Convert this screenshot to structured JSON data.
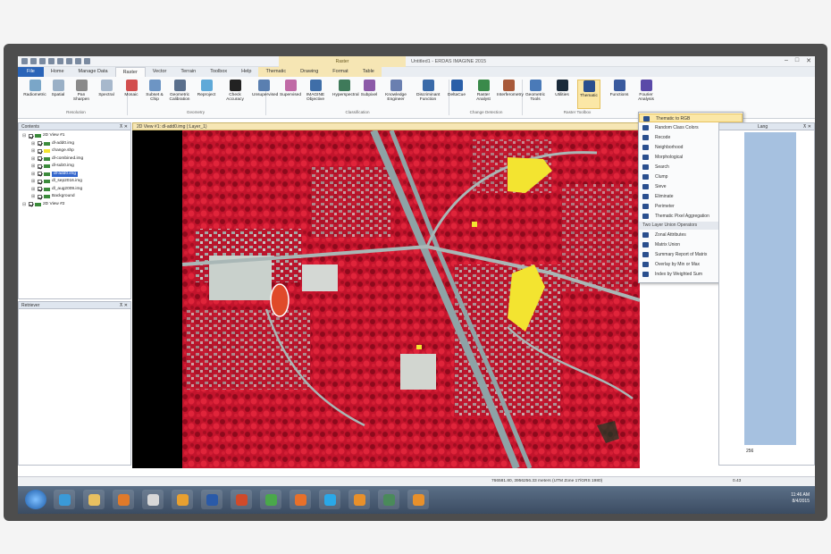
{
  "app": {
    "title": "Untitled1 - ERDAS IMAGINE 2015",
    "context_group": "Raster"
  },
  "tabs": [
    {
      "label": "File"
    },
    {
      "label": "Home"
    },
    {
      "label": "Manage Data"
    },
    {
      "label": "Raster"
    },
    {
      "label": "Vector"
    },
    {
      "label": "Terrain"
    },
    {
      "label": "Toolbox"
    },
    {
      "label": "Help"
    },
    {
      "label": "Thematic"
    },
    {
      "label": "Drawing"
    },
    {
      "label": "Format"
    },
    {
      "label": "Table"
    }
  ],
  "ribbon": {
    "buttons": [
      {
        "label": "Radiometric",
        "color": "#7aa6c8"
      },
      {
        "label": "Spatial",
        "color": "#9ab0c6"
      },
      {
        "label": "Pan Sharpen",
        "color": "#8a8a8a"
      },
      {
        "label": "Spectral",
        "color": "#a7b8cc"
      },
      {
        "label": "Mosaic",
        "color": "#d24e4e"
      },
      {
        "label": "Subset & Chip",
        "color": "#6d95c4"
      },
      {
        "label": "Geometric Calibration",
        "color": "#5a6f8c"
      },
      {
        "label": "Reproject",
        "color": "#5fa9d8"
      },
      {
        "label": "Check Accuracy",
        "color": "#222222"
      },
      {
        "label": "Unsupervised",
        "color": "#5a7fb0"
      },
      {
        "label": "Supervised",
        "color": "#c06aa6"
      },
      {
        "label": "IMAGINE Objective",
        "color": "#3f6ea8"
      },
      {
        "label": "Hyperspectral",
        "color": "#3f7a5a"
      },
      {
        "label": "Subpixel",
        "color": "#8c5aa8"
      },
      {
        "label": "Knowledge Engineer",
        "color": "#6a7fb0"
      },
      {
        "label": "Discriminant Function",
        "color": "#3a6aa8"
      },
      {
        "label": "DeltaCue",
        "color": "#2a5fa8"
      },
      {
        "label": "Raster Analyst",
        "color": "#3a8a4a"
      },
      {
        "label": "Interferometry",
        "color": "#a85a3a"
      },
      {
        "label": "Geometric Tools",
        "color": "#4a7ab8"
      },
      {
        "label": "Utilities",
        "color": "#1a2a3a"
      },
      {
        "label": "Thematic",
        "color": "#2a4f8e"
      },
      {
        "label": "Functions",
        "color": "#3a5a9e"
      },
      {
        "label": "Fourier Analysis",
        "color": "#5a4aa8"
      }
    ],
    "groups": [
      "Resolution",
      "Geometry",
      "Classification",
      "Change Detection",
      "Raster Toolbox"
    ]
  },
  "contents_panel": {
    "title": "Contents",
    "items": [
      {
        "label": "2D View #1",
        "level": 0
      },
      {
        "label": "dl-add0.img",
        "level": 1
      },
      {
        "label": "change.shp",
        "level": 1
      },
      {
        "label": "dl-combined.img",
        "level": 1
      },
      {
        "label": "dl-sub0.img",
        "level": 1
      },
      {
        "label": "dl-add0.img",
        "level": 1,
        "selected": true
      },
      {
        "label": "dl_sep2016.img",
        "level": 1
      },
      {
        "label": "dl_aug2009.img",
        "level": 1
      },
      {
        "label": "Background",
        "level": 1
      },
      {
        "label": "2D View #2",
        "level": 0
      }
    ]
  },
  "retriever_panel": {
    "title": "Retriever"
  },
  "view": {
    "tab_label": "2D View #1: dl-add0.img (:Layer_1)"
  },
  "dropdown": {
    "items": [
      {
        "label": "Thematic to RGB",
        "highlighted": true
      },
      {
        "label": "Random Class Colors"
      },
      {
        "label": "Recode"
      },
      {
        "label": "Neighborhood"
      },
      {
        "label": "Morphological"
      },
      {
        "label": "Search"
      },
      {
        "label": "Clump"
      },
      {
        "label": "Sieve"
      },
      {
        "label": "Eliminate"
      },
      {
        "label": "Perimeter"
      },
      {
        "label": "Thematic Pixel Aggregation"
      }
    ],
    "section_header": "Two Layer Union Operators",
    "items2": [
      {
        "label": "Zonal Attributes"
      },
      {
        "label": "Matrix Union"
      },
      {
        "label": "Summary Report of Matrix"
      },
      {
        "label": "Overlay by Min or Max"
      },
      {
        "label": "Index by Weighted Sum"
      }
    ]
  },
  "right_panel": {
    "title": "Lang",
    "bottom_value": "256"
  },
  "status": {
    "coords": "766581.80, 3956256.33 meters (UTM Zone 17/GRS 1980)",
    "zoom": "0.43"
  },
  "taskbar": {
    "icons": [
      {
        "name": "ie",
        "color": "#3a9ad8"
      },
      {
        "name": "explorer",
        "color": "#e8c060"
      },
      {
        "name": "media",
        "color": "#e07a2a"
      },
      {
        "name": "notes",
        "color": "#d8d8d8"
      },
      {
        "name": "outlook",
        "color": "#e8a030"
      },
      {
        "name": "word",
        "color": "#2a5aa8"
      },
      {
        "name": "powerpoint",
        "color": "#d04a2a"
      },
      {
        "name": "chrome",
        "color": "#4aa84a"
      },
      {
        "name": "firefox",
        "color": "#e8702a"
      },
      {
        "name": "skype",
        "color": "#2aa8e8"
      },
      {
        "name": "imagine",
        "color": "#e8902a"
      },
      {
        "name": "tool",
        "color": "#4a8a5a"
      },
      {
        "name": "imagine2",
        "color": "#e8902a"
      }
    ],
    "clock_time": "11:46 AM",
    "clock_date": "8/4/2015"
  }
}
